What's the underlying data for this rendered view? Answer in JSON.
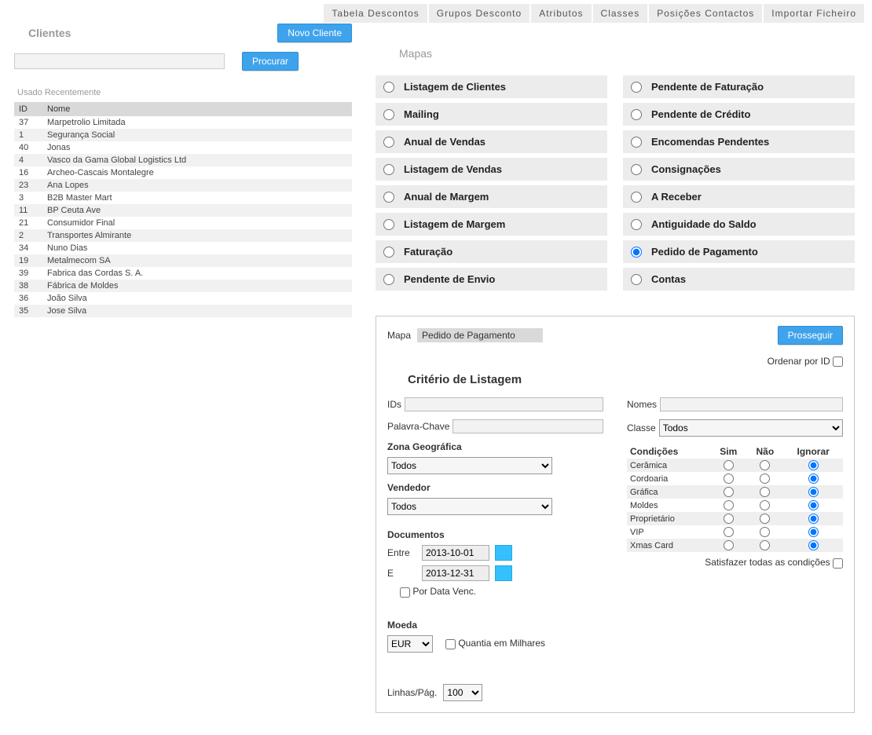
{
  "tabs": [
    "Tabela Descontos",
    "Grupos Desconto",
    "Atributos",
    "Classes",
    "Posições Contactos",
    "Importar Ficheiro"
  ],
  "left": {
    "title": "Clientes",
    "new_button": "Novo Cliente",
    "search_button": "Procurar",
    "recent_label": "Usado Recentemente",
    "col_id": "ID",
    "col_name": "Nome",
    "rows": [
      {
        "id": "37",
        "name": "Marpetrolio Limitada"
      },
      {
        "id": "1",
        "name": "Segurança Social"
      },
      {
        "id": "40",
        "name": "Jonas"
      },
      {
        "id": "4",
        "name": "Vasco da Gama Global Logistics Ltd"
      },
      {
        "id": "16",
        "name": "Archeo-Cascais Montalegre"
      },
      {
        "id": "23",
        "name": "Ana Lopes"
      },
      {
        "id": "3",
        "name": "B2B Master Mart"
      },
      {
        "id": "11",
        "name": "BP Ceuta Ave"
      },
      {
        "id": "21",
        "name": "Consumidor Final"
      },
      {
        "id": "2",
        "name": "Transportes Almirante"
      },
      {
        "id": "34",
        "name": "Nuno Dias"
      },
      {
        "id": "19",
        "name": "Metalmecom SA"
      },
      {
        "id": "39",
        "name": "Fabrica das Cordas S. A."
      },
      {
        "id": "38",
        "name": "Fábrica de Moldes"
      },
      {
        "id": "36",
        "name": "João Silva"
      },
      {
        "id": "35",
        "name": "Jose Silva"
      }
    ]
  },
  "mapas": {
    "title": "Mapas",
    "left_options": [
      "Listagem de Clientes",
      "Mailing",
      "Anual de Vendas",
      "Listagem de Vendas",
      "Anual de Margem",
      "Listagem de Margem",
      "Faturação",
      "Pendente de Envio"
    ],
    "right_options": [
      "Pendente de Faturação",
      "Pendente de Crédito",
      "Encomendas Pendentes",
      "Consignações",
      "A Receber",
      "Antiguidade do Saldo",
      "Pedido de Pagamento",
      "Contas"
    ],
    "selected": "Pedido de Pagamento"
  },
  "criteria": {
    "mapa_label": "Mapa",
    "mapa_value": "Pedido de Pagamento",
    "proceed": "Prosseguir",
    "order_by_id": "Ordenar por ID",
    "title": "Critério de Listagem",
    "ids_label": "IDs",
    "names_label": "Nomes",
    "keyword_label": "Palavra-Chave",
    "class_label": "Classe",
    "class_value": "Todos",
    "zone_label": "Zona Geográfica",
    "zone_value": "Todos",
    "seller_label": "Vendedor",
    "seller_value": "Todos",
    "documents_label": "Documentos",
    "between_label": "Entre",
    "and_label": "E",
    "date_from": "2013-10-01",
    "date_to": "2013-12-31",
    "by_due_date": "Por Data Venc.",
    "currency_label": "Moeda",
    "currency_value": "EUR",
    "thousands_label": "Quantia em Milhares",
    "conditions_label": "Condições",
    "col_yes": "Sim",
    "col_no": "Não",
    "col_ignore": "Ignorar",
    "conditions": [
      "Cerâmica",
      "Cordoaria",
      "Gráfica",
      "Moldes",
      "Proprietário",
      "VIP",
      "Xmas Card"
    ],
    "satisfy_all": "Satisfazer todas as condições",
    "lines_per_page_label": "Linhas/Pág.",
    "lines_per_page_value": "100"
  }
}
